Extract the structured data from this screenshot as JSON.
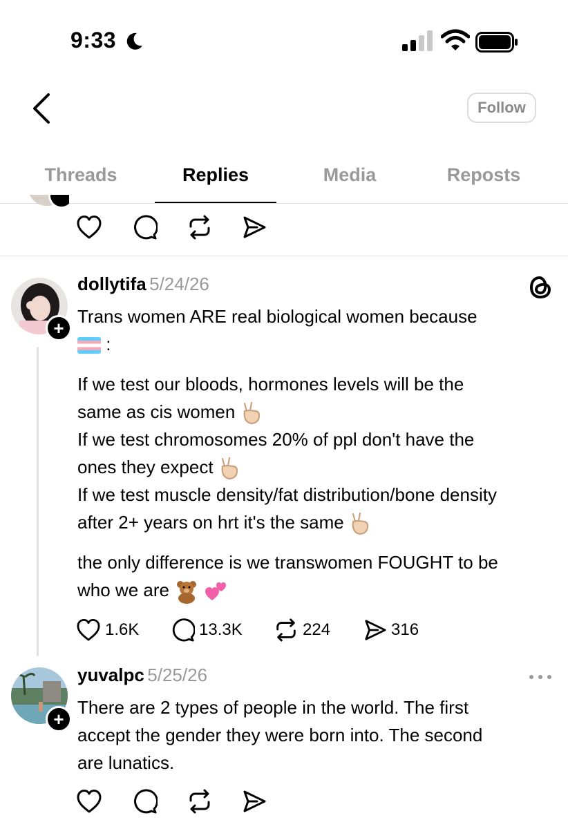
{
  "status_bar": {
    "time": "9:33"
  },
  "header": {
    "follow_label": "Follow"
  },
  "tabs": [
    {
      "label": "Threads"
    },
    {
      "label": "Replies"
    },
    {
      "label": "Media"
    },
    {
      "label": "Reposts"
    }
  ],
  "posts": [
    {
      "username": "dollytifa",
      "date": "5/24/26",
      "lines": [
        "Trans women ARE real biological women because",
        ":",
        "If we test our bloods, hormones levels will be the",
        "same as cis women",
        "If we test chromosomes 20% of ppl don't have the",
        "ones they expect",
        "If we test muscle density/fat distribution/bone density",
        "after 2+ years on hrt it's the same",
        "the only difference is we transwomen FOUGHT to be",
        "who we are"
      ],
      "likes": "1.6K",
      "replies": "13.3K",
      "reposts": "224",
      "shares": "316"
    },
    {
      "username": "yuvalpc",
      "date": "5/25/26",
      "lines": [
        "There are 2 types of people in the world. The first",
        "accept the gender they were born into. The second",
        "are lunatics."
      ]
    }
  ],
  "icons": [
    "moon-icon",
    "signal-icon",
    "wifi-icon",
    "battery-icon",
    "back-chevron-icon",
    "heart-icon",
    "comment-icon",
    "repost-icon",
    "share-icon",
    "threads-logo-icon",
    "more-icon",
    "plus-icon",
    "trans-flag-icon",
    "peace-hand-icon",
    "teddy-bear-icon",
    "hearts-icon"
  ]
}
